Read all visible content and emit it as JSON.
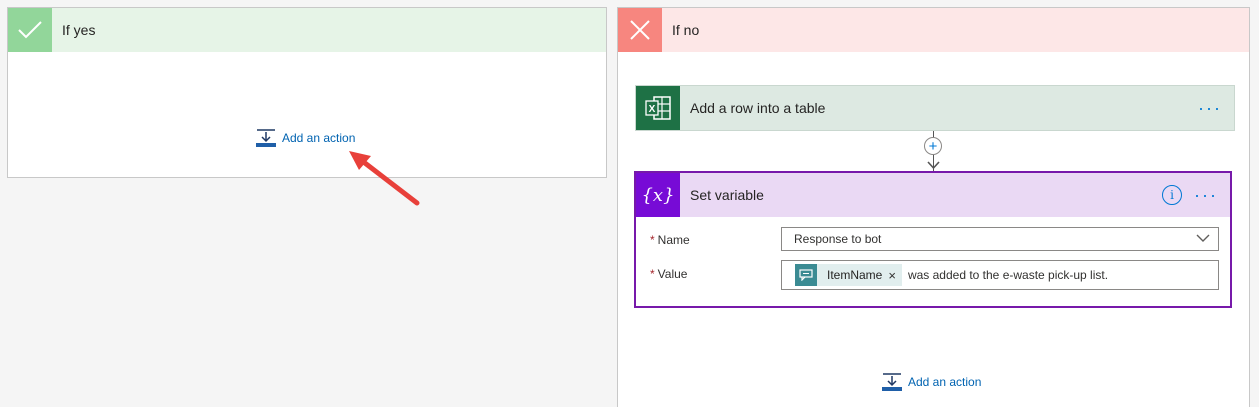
{
  "yes_branch": {
    "title": "If yes",
    "add_action_label": "Add an action"
  },
  "no_branch": {
    "title": "If no",
    "add_action_label": "Add an action",
    "excel_action": {
      "title": "Add a row into a table",
      "more_label": "···"
    },
    "insert_step_label": "+",
    "set_variable": {
      "title": "Set variable",
      "icon_text": "{x}",
      "info_label": "i",
      "more_label": "···",
      "fields": {
        "name": {
          "required_mark": "*",
          "label": "Name",
          "value": "Response to bot"
        },
        "value": {
          "required_mark": "*",
          "label": "Value",
          "token_label": "ItemName",
          "token_remove": "×",
          "text": "was added to the e-waste pick-up list."
        }
      }
    }
  },
  "colors": {
    "yes_accent": "#92d69a",
    "no_accent": "#f7867f",
    "excel_green": "#1e7145",
    "variable_purple": "#770bd6",
    "link_blue": "#0063b1",
    "annotation_red": "#e8403a"
  },
  "icons": [
    "check-icon",
    "close-icon",
    "add-action-icon",
    "excel-icon",
    "more-icon",
    "plus-icon",
    "down-arrow-icon",
    "variable-icon",
    "info-icon",
    "chevron-down-icon",
    "chat-icon",
    "annotation-arrow"
  ]
}
